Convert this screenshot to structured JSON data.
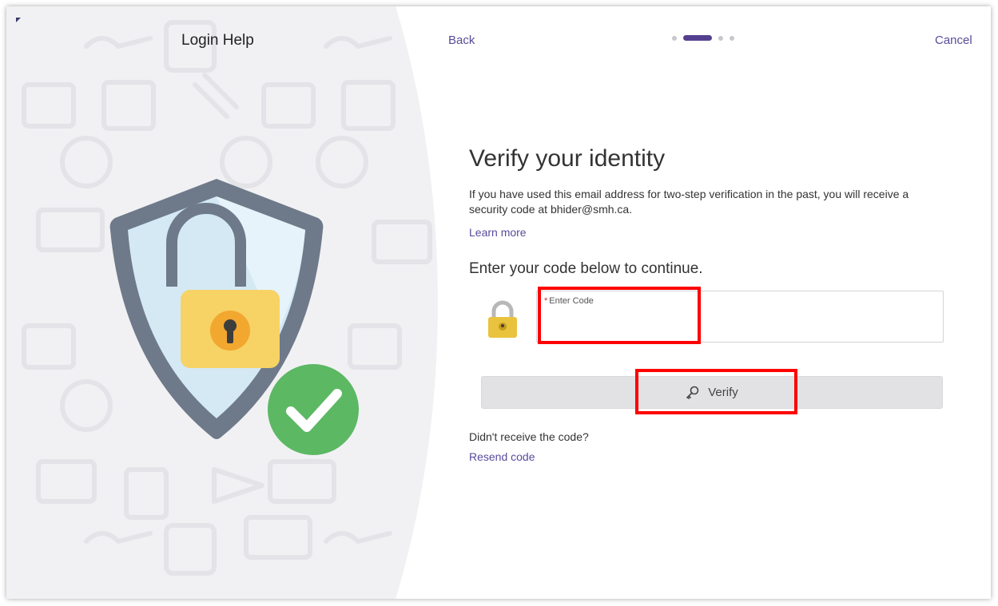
{
  "left_panel": {
    "title": "Login Help"
  },
  "nav": {
    "back_label": "Back",
    "cancel_label": "Cancel",
    "steps": {
      "total": 4,
      "current": 2
    }
  },
  "main": {
    "heading": "Verify your identity",
    "description": "If you have used this email address for two-step verification in the past, you will receive a security code at bhider@smh.ca.",
    "learn_more": "Learn more",
    "prompt": "Enter your code below to continue.",
    "code_field": {
      "required_mark": "*",
      "label": "Enter Code",
      "value": ""
    },
    "verify_label": "Verify",
    "no_code_text": "Didn't receive the code?",
    "resend_label": "Resend code"
  },
  "colors": {
    "accent": "#54408f",
    "link": "#5a4a9a",
    "highlight": "#ff0000",
    "shield_blue": "#d4e9f4",
    "shield_border": "#6e7a8a",
    "lock_yellow": "#f7d265",
    "check_green": "#5cb863"
  },
  "icons": [
    "shield-lock-illustration",
    "lock-icon",
    "key-icon",
    "checkmark-icon"
  ]
}
